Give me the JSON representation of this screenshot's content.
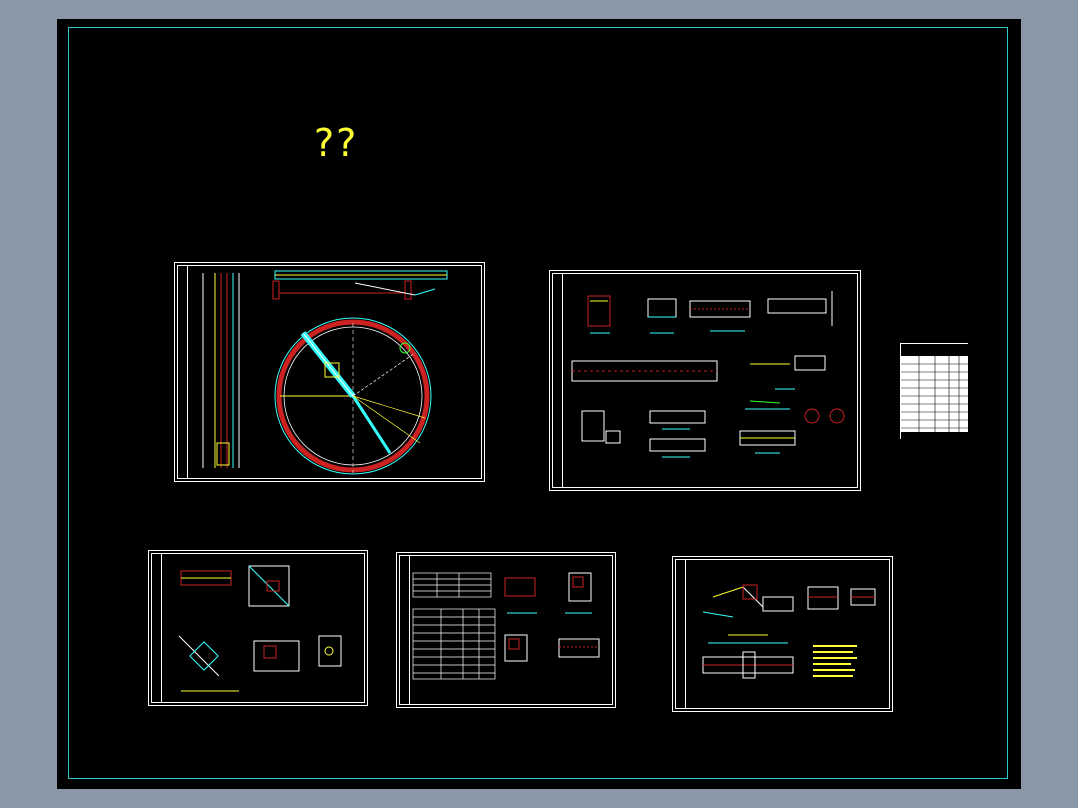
{
  "title_mark": "??",
  "colors": {
    "background": "#8a97a6",
    "drawing_bg": "#000000",
    "frame": "#2fc8c8",
    "sheet_border": "#ffffff",
    "cad_red": "#cc2222",
    "cad_yellow": "#ffff33",
    "cad_cyan": "#33ffff",
    "cad_green": "#33ff33",
    "cad_blue": "#3366ff",
    "cad_magenta": "#ff33ff"
  },
  "sheets": [
    {
      "id": "sheet-1",
      "content": "circular-clarifier-plan-and-section"
    },
    {
      "id": "sheet-2",
      "content": "detail-drawings"
    },
    {
      "id": "sheet-3",
      "content": "node-details"
    },
    {
      "id": "sheet-4",
      "content": "tables-and-sections"
    },
    {
      "id": "sheet-5",
      "content": "weir-details"
    }
  ]
}
